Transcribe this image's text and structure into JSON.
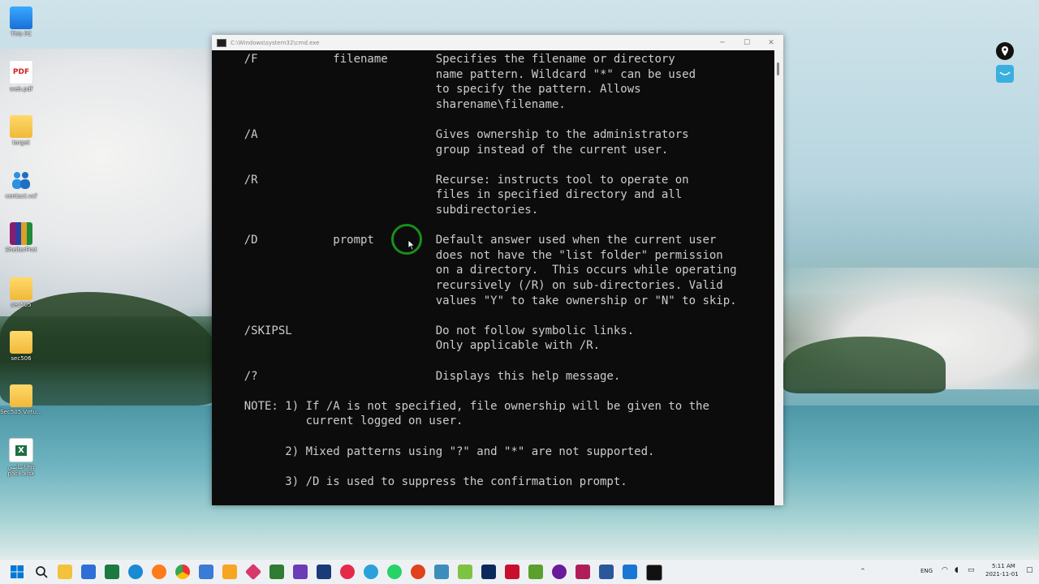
{
  "desktop": {
    "icons": [
      {
        "label": "This PC",
        "icon": "monitor-icon"
      },
      {
        "label": "web.pdf",
        "icon": "pdf-icon"
      },
      {
        "label": "target",
        "icon": "folder-icon"
      },
      {
        "label": "contact.vcf",
        "icon": "contacts-icon"
      },
      {
        "label": "ShelterProt",
        "icon": "winrar-icon"
      },
      {
        "label": "sec505",
        "icon": "folder-icon"
      },
      {
        "label": "sec506",
        "icon": "folder-icon"
      },
      {
        "label": "Sec505 Virtu...",
        "icon": "folder-shortcut-icon"
      },
      {
        "label": "اساسي hp pack.xlsx",
        "icon": "excel-icon"
      }
    ]
  },
  "window": {
    "title": "C:\\Windows\\system32\\cmd.exe",
    "minimize": "─",
    "maximize": "☐",
    "close": "✕"
  },
  "console": {
    "lines": [
      "    /F           filename       Specifies the filename or directory",
      "                                name pattern. Wildcard \"*\" can be used",
      "                                to specify the pattern. Allows",
      "                                sharename\\filename.",
      "",
      "    /A                          Gives ownership to the administrators",
      "                                group instead of the current user.",
      "",
      "    /R                          Recurse: instructs tool to operate on",
      "                                files in specified directory and all",
      "                                subdirectories.",
      "",
      "    /D           prompt         Default answer used when the current user",
      "                                does not have the \"list folder\" permission",
      "                                on a directory.  This occurs while operating",
      "                                recursively (/R) on sub-directories. Valid",
      "                                values \"Y\" to take ownership or \"N\" to skip.",
      "",
      "    /SKIPSL                     Do not follow symbolic links.",
      "                                Only applicable with /R.",
      "",
      "    /?                          Displays this help message.",
      "",
      "    NOTE: 1) If /A is not specified, file ownership will be given to the",
      "             current logged on user.",
      "",
      "          2) Mixed patterns using \"?\" and \"*\" are not supported.",
      "",
      "          3) /D is used to suppress the confirmation prompt."
    ]
  },
  "tray": {
    "language": "ENG",
    "time": "5:11 AM",
    "date": "2021-11-01"
  },
  "colors": {
    "console_bg": "#0c0c0c",
    "console_fg": "#cccccc",
    "click_ring": "#1a8f1a",
    "taskbar_bg": "#eef1f4"
  }
}
